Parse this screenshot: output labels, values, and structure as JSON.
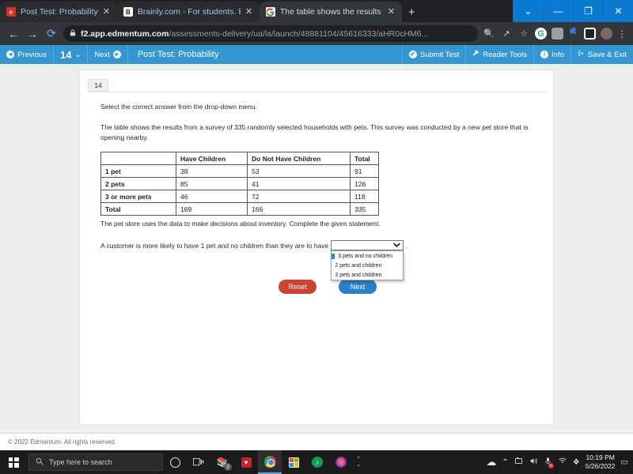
{
  "browser": {
    "tabs": [
      {
        "title": "Post Test: Probability",
        "favicon": "edmentum-favicon",
        "active": false,
        "close": "✕"
      },
      {
        "title": "Brainly.com - For students. By stu",
        "favicon": "brainly-favicon",
        "active": false,
        "close": "✕"
      },
      {
        "title": "The table shows the results from",
        "favicon": "google-favicon",
        "active": true,
        "close": "✕"
      }
    ],
    "new_tab_label": "+",
    "window_controls": [
      {
        "name": "tab-search-button",
        "glyph": "⌄"
      },
      {
        "name": "minimize-button",
        "glyph": "—"
      },
      {
        "name": "maximize-button",
        "glyph": "❐"
      },
      {
        "name": "close-window-button",
        "glyph": "✕"
      }
    ],
    "nav": {
      "back": "←",
      "forward": "→",
      "reload": "⟳"
    },
    "url": {
      "lock": "🔒",
      "host": "f2.app.edmentum.com",
      "path": "/assessments-delivery/ua/la/launch/48881104/45616333/aHR0cHM6..."
    },
    "omnibox_buttons": [
      {
        "name": "zoom-search-icon",
        "glyph": "🔍"
      },
      {
        "name": "share-icon",
        "glyph": "↗"
      },
      {
        "name": "bookmark-star-icon",
        "glyph": "☆"
      }
    ],
    "extensions": [
      {
        "name": "grammarly-extension-icon",
        "glyph": "G"
      },
      {
        "name": "generic-extension-icon",
        "glyph": ""
      },
      {
        "name": "puzzle-extensions-icon",
        "glyph": "✦"
      },
      {
        "name": "sidebar-extension-icon",
        "glyph": ""
      },
      {
        "name": "profile-avatar-icon",
        "glyph": ""
      }
    ],
    "menu_icon": "⋮"
  },
  "edmentum_toolbar": {
    "previous_label": "Previous",
    "previous_icon": "◄",
    "page_number": "14",
    "page_chevron": "⌄",
    "next_label": "Next",
    "next_icon": "►",
    "title": "Post Test: Probability",
    "right_items": [
      {
        "label": "Submit Test",
        "icon": "✔"
      },
      {
        "label": "Reader Tools",
        "icon": "🔧"
      },
      {
        "label": "Info",
        "icon": "i"
      },
      {
        "label": "Save & Exit",
        "icon": "⏻"
      }
    ]
  },
  "question": {
    "number": "14",
    "instruction": "Select the correct answer from the drop-down menu.",
    "prompt": "The table shows the results from a survey of 335 randomly selected households with pets. This survey was conducted by a new pet store that is opening nearby.",
    "statement_intro": "The pet store uses the data to make decisions about inventory. Complete the given statement.",
    "answer_sentence_before": "A customer is more likely to have 1 pet and no children than they are to have",
    "answer_sentence_after": "."
  },
  "table": {
    "headers": [
      "",
      "Have Children",
      "Do Not Have Children",
      "Total"
    ],
    "rows": [
      {
        "label": "1 pet",
        "have_children": "38",
        "no_children": "53",
        "total": "91"
      },
      {
        "label": "2 pets",
        "have_children": "85",
        "no_children": "41",
        "total": "126"
      },
      {
        "label": "3 or more pets",
        "have_children": "46",
        "no_children": "72",
        "total": "118"
      },
      {
        "label": "Total",
        "have_children": "169",
        "no_children": "166",
        "total": "335"
      }
    ]
  },
  "dropdown": {
    "selected_value": "",
    "chevron": "⌄",
    "open": true,
    "highlighted_index": 0,
    "options": [
      "",
      "3 pets and no children",
      "2 pets and children",
      "3 pets and children"
    ]
  },
  "buttons": {
    "reset_label": "Reset",
    "next_label": "Next"
  },
  "footer": {
    "copyright": "© 2022 Edmentum. All rights reserved."
  },
  "taskbar": {
    "search_placeholder": "Type here to search",
    "search_icon": "🔍",
    "items": [
      {
        "name": "cortana-icon",
        "glyph": ""
      },
      {
        "name": "task-view-icon",
        "glyph": ""
      },
      {
        "name": "books-icon",
        "glyph": "",
        "badge": "3"
      },
      {
        "name": "iheartradio-icon",
        "glyph": "♥"
      },
      {
        "name": "chrome-icon",
        "glyph": ""
      },
      {
        "name": "microsoft-store-icon",
        "glyph": ""
      },
      {
        "name": "spotify-icon",
        "glyph": "♪"
      },
      {
        "name": "itunes-icon",
        "glyph": ""
      }
    ],
    "tray": [
      {
        "name": "onedrive-cloud-icon",
        "glyph": "☁"
      },
      {
        "name": "show-hidden-icons-chevron",
        "glyph": "⌃"
      },
      {
        "name": "screen-capture-icon",
        "glyph": "▣"
      },
      {
        "name": "volume-icon",
        "glyph": "🔊"
      },
      {
        "name": "microphone-muted-icon",
        "glyph": "🎤"
      },
      {
        "name": "wifi-icon",
        "glyph": "📶"
      },
      {
        "name": "dropbox-icon",
        "glyph": "❖"
      }
    ],
    "time": "10:19 PM",
    "date": "5/26/2022",
    "notification_icon": "▭"
  },
  "colors": {
    "edmentum_blue": "#3397d3",
    "reset_red": "#cf4130",
    "next_blue": "#2a7fc9",
    "highlight_blue": "#2a8fd8"
  }
}
